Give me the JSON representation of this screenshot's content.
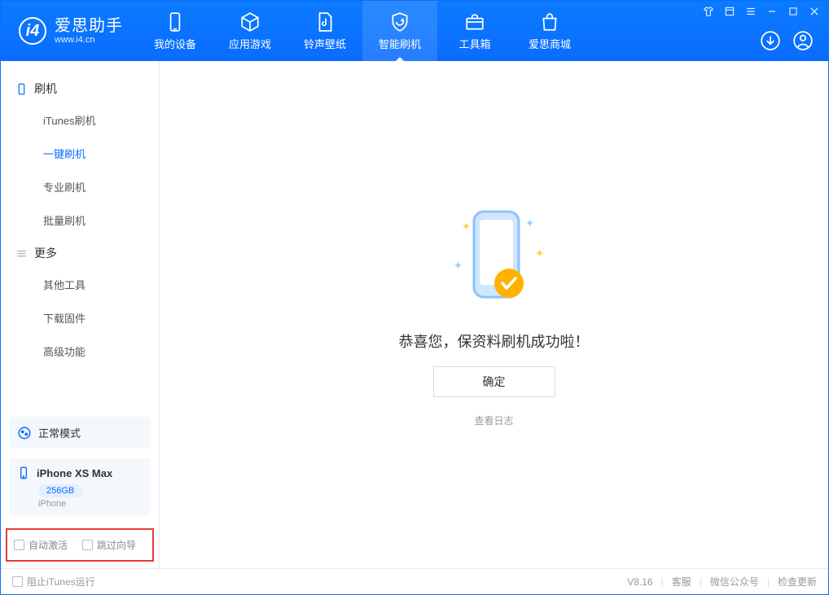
{
  "app": {
    "name": "爱思助手",
    "url": "www.i4.cn"
  },
  "tabs": [
    {
      "label": "我的设备"
    },
    {
      "label": "应用游戏"
    },
    {
      "label": "铃声壁纸"
    },
    {
      "label": "智能刷机"
    },
    {
      "label": "工具箱"
    },
    {
      "label": "爱思商城"
    }
  ],
  "sidebar": {
    "group_flash": "刷机",
    "flash_items": [
      "iTunes刷机",
      "一键刷机",
      "专业刷机",
      "批量刷机"
    ],
    "group_more": "更多",
    "more_items": [
      "其他工具",
      "下载固件",
      "高级功能"
    ]
  },
  "mode_panel": {
    "label": "正常模式"
  },
  "device": {
    "name": "iPhone XS Max",
    "capacity": "256GB",
    "type": "iPhone"
  },
  "checkboxes": {
    "auto_activate": "自动激活",
    "skip_guide": "跳过向导"
  },
  "result": {
    "message": "恭喜您，保资料刷机成功啦！",
    "ok": "确定",
    "view_log": "查看日志"
  },
  "status": {
    "block_itunes": "阻止iTunes运行",
    "version": "V8.16",
    "support": "客服",
    "wechat": "微信公众号",
    "update": "检查更新"
  }
}
